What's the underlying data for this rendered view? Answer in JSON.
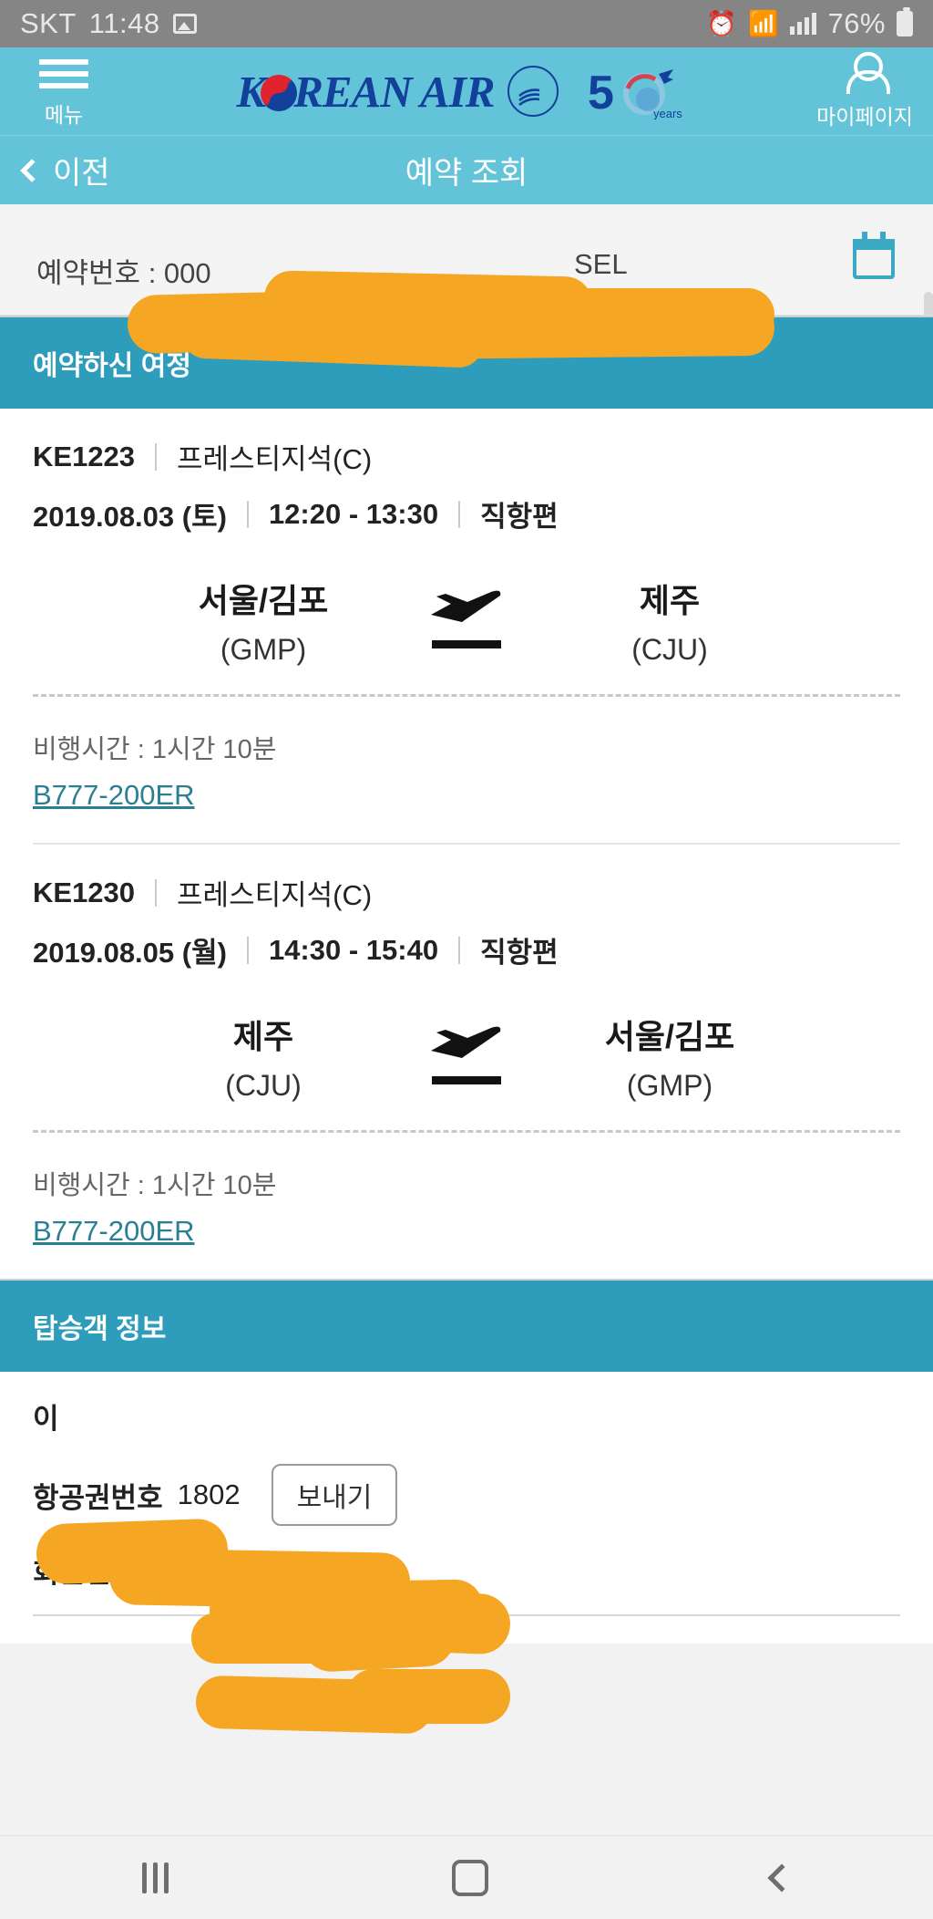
{
  "statusbar": {
    "carrier": "SKT",
    "time": "11:48",
    "battery_percent": "76%",
    "icons": [
      "image-icon",
      "alarm-icon",
      "wifi-icon",
      "signal-icon",
      "battery-icon"
    ]
  },
  "header": {
    "menu_label": "메뉴",
    "brand": "KOREAN AIR",
    "alliance_badge": "SKYTEAM",
    "anniversary": "50",
    "anniversary_sub": "years",
    "mypage_label": "마이페이지"
  },
  "subnav": {
    "back_label": "이전",
    "title": "예약 조회"
  },
  "booking_strip": {
    "booking_label": "예약번호 : ",
    "booking_value": "000",
    "city_code": "SEL",
    "calendar_icon": "calendar-icon"
  },
  "itinerary": {
    "section_title": "예약하신 여정",
    "flights": [
      {
        "flight_no": "KE1223",
        "cabin": "프레스티지석(C)",
        "date": "2019.08.03 (토)",
        "time": "12:20 - 13:30",
        "type": "직항편",
        "from_name": "서울/김포",
        "from_code": "(GMP)",
        "to_name": "제주",
        "to_code": "(CJU)",
        "duration": "비행시간 : 1시간 10분",
        "aircraft": "B777-200ER"
      },
      {
        "flight_no": "KE1230",
        "cabin": "프레스티지석(C)",
        "date": "2019.08.05 (월)",
        "time": "14:30 - 15:40",
        "type": "직항편",
        "from_name": "제주",
        "from_code": "(CJU)",
        "to_name": "서울/김포",
        "to_code": "(GMP)",
        "duration": "비행시간 : 1시간 10분",
        "aircraft": "B777-200ER"
      }
    ]
  },
  "passenger": {
    "section_title": "탑승객 정보",
    "name": "이",
    "ticket_label": "항공권번호",
    "ticket_value": "1802",
    "send_button": "보내기",
    "member_label": "회원번호 : KE",
    "member_value": ""
  },
  "bottom_nav": {
    "recents": "recents-icon",
    "home": "home-icon",
    "back": "back-icon"
  },
  "colors": {
    "brand_cyan": "#63c3d9",
    "section_teal": "#2e9cbb",
    "brand_navy": "#12409a",
    "link_teal": "#2a7f95",
    "redaction": "#f5a623",
    "statusbar_gray": "#858585"
  }
}
